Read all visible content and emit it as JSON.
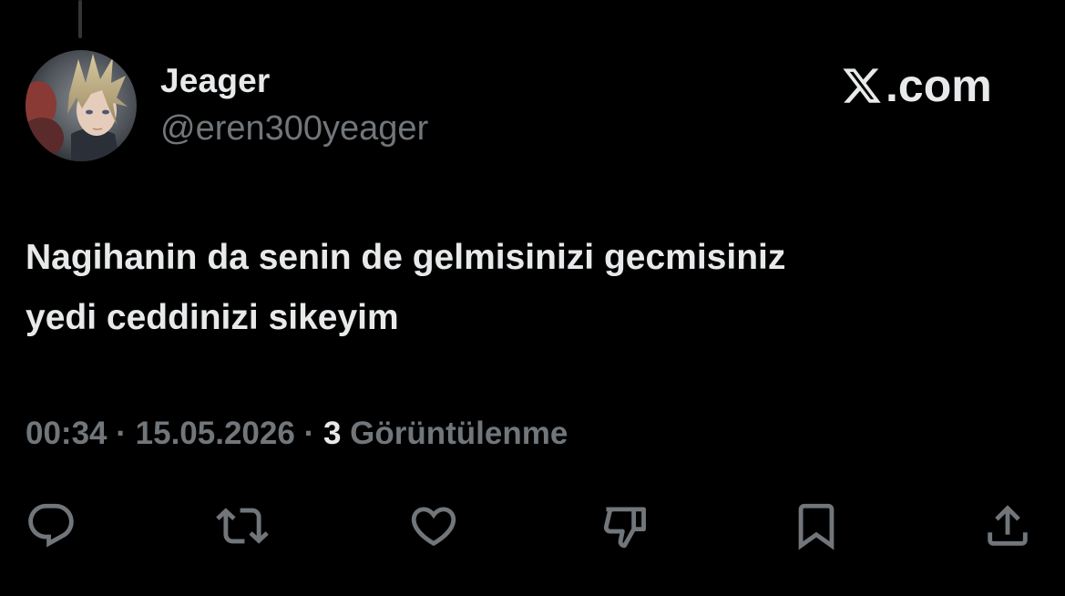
{
  "tweet": {
    "author": {
      "display_name": "Jeager",
      "handle": "@eren300yeager",
      "avatar_icon": "anime-character-avatar"
    },
    "brand": {
      "icon": "x-logo-icon",
      "suffix": ".com"
    },
    "text_lines": [
      "Nagihanin da senin de gelmisinizi gecmisiniz",
      "yedi ceddinizi sikeyim"
    ],
    "meta": {
      "time": "00:34",
      "separator": "·",
      "date": "15.05.2026",
      "views_count": "3",
      "views_label": "Görüntülenme"
    },
    "actions": [
      {
        "name": "reply",
        "icon": "reply-icon"
      },
      {
        "name": "retweet",
        "icon": "retweet-icon"
      },
      {
        "name": "like",
        "icon": "heart-icon"
      },
      {
        "name": "dislike",
        "icon": "thumbs-down-icon"
      },
      {
        "name": "bookmark",
        "icon": "bookmark-icon"
      },
      {
        "name": "share",
        "icon": "share-icon"
      }
    ],
    "colors": {
      "background": "#000000",
      "primary_text": "#e7e9ea",
      "secondary_text": "#71767b"
    }
  }
}
